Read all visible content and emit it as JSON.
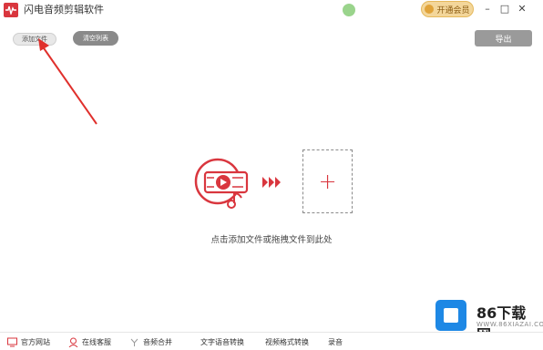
{
  "app": {
    "title": "闪电音频剪辑软件"
  },
  "titlebar": {
    "vip_label": "开通会员",
    "minimize": "–",
    "maximize": "□",
    "close": "✕"
  },
  "toolbar": {
    "add_file_label": "添加文件",
    "clear_list_label": "清空列表",
    "export_label": "导出"
  },
  "drop_zone": {
    "hint": "点击添加文件或拖拽文件到此处",
    "plus": "+",
    "chevrons": "▶▶▶"
  },
  "watermark": {
    "title": "86下载网",
    "subtitle": "WWW.86XIAZAI.COM"
  },
  "bottom_nav": {
    "items": [
      {
        "label": "官方网站",
        "icon": "monitor-icon"
      },
      {
        "label": "在线客服",
        "icon": "support-agent-icon"
      },
      {
        "label": "音频合并",
        "icon": "merge-icon"
      },
      {
        "label": "文字语音转换",
        "icon": "text-speech-icon"
      },
      {
        "label": "视频格式转换",
        "icon": "video-convert-icon"
      },
      {
        "label": "录音",
        "icon": "record-icon"
      }
    ]
  },
  "colors": {
    "accent": "#d9363e",
    "annotation_arrow": "#e0302c"
  }
}
